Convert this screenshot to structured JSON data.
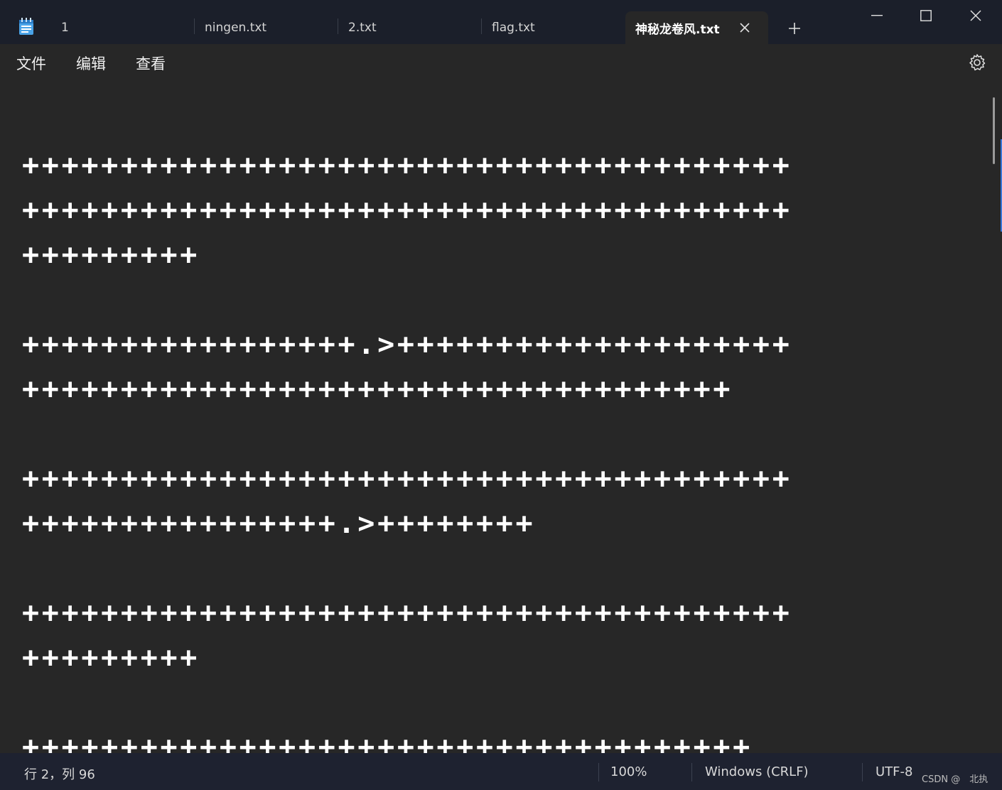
{
  "tabs": [
    {
      "label": "1"
    },
    {
      "label": "ningen.txt"
    },
    {
      "label": "2.txt"
    },
    {
      "label": "flag.txt"
    },
    {
      "label": "神秘龙卷风.txt",
      "active": true
    }
  ],
  "menu": {
    "file": "文件",
    "edit": "编辑",
    "view": "查看"
  },
  "editor": {
    "lines": [
      "+++++++++++++++++++++++++++++++++++++++",
      "+++++++++++++++++++++++++++++++++++++++",
      "+++++++++",
      "",
      "+++++++++++++++++.>++++++++++++++++++++",
      "++++++++++++++++++++++++++++++++++++",
      "",
      "+++++++++++++++++++++++++++++++++++++++",
      "++++++++++++++++.>++++++++",
      "",
      "+++++++++++++++++++++++++++++++++++++++",
      "+++++++++",
      "",
      "+++++++++++++++++++++++++++++++++++++"
    ]
  },
  "status": {
    "position": "行 2，列 96",
    "zoom": "100%",
    "line_ending": "Windows (CRLF)",
    "encoding": "UTF-8",
    "watermark": "CSDN @　北执"
  },
  "colors": {
    "titlebar": "#1b1f2a",
    "editor_bg": "#272727",
    "statusbar": "#1e2230",
    "accent": "#3a78d8"
  },
  "icons": [
    "notepad-icon",
    "close-icon",
    "plus-icon",
    "minimize-icon",
    "maximize-icon",
    "gear-icon"
  ]
}
